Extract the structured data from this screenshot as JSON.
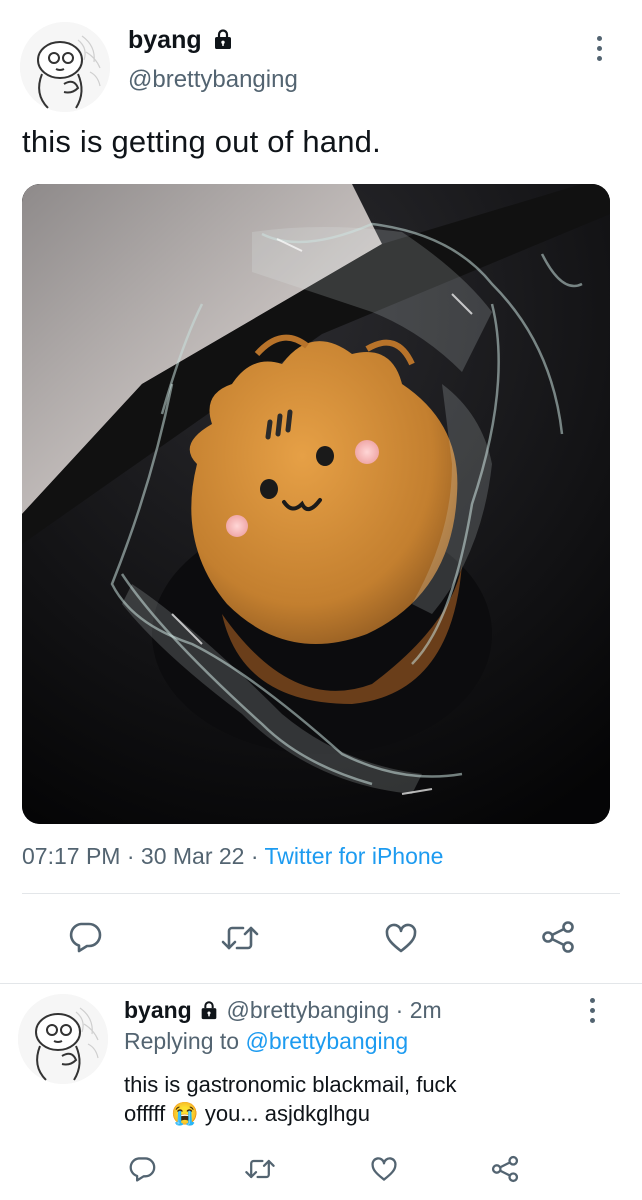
{
  "tweet": {
    "display_name": "byang",
    "handle": "@brettybanging",
    "text": "this is getting out of hand.",
    "time": "07:17 PM",
    "sep1": " · ",
    "date": "30 Mar 22",
    "sep2": " · ",
    "source": "Twitter for iPhone",
    "icons": [
      "lock-icon",
      "more-vertical-icon",
      "reply-icon",
      "retweet-icon",
      "like-icon",
      "share-icon"
    ]
  },
  "reply": {
    "display_name": "byang",
    "handle": "@brettybanging",
    "sep": " · ",
    "age": "2m",
    "replying_prefix": "Replying to ",
    "replying_to": "@brettybanging",
    "text_line1": "this is gastronomic blackmail, fuck",
    "text_line2_a": "offfff ",
    "emoji": "😭",
    "text_line2_b": " you... asjdkglhgu"
  },
  "colors": {
    "text": "#0f1419",
    "secondary": "#536471",
    "accent": "#1d9bf0",
    "divider": "#e3e6e9"
  }
}
